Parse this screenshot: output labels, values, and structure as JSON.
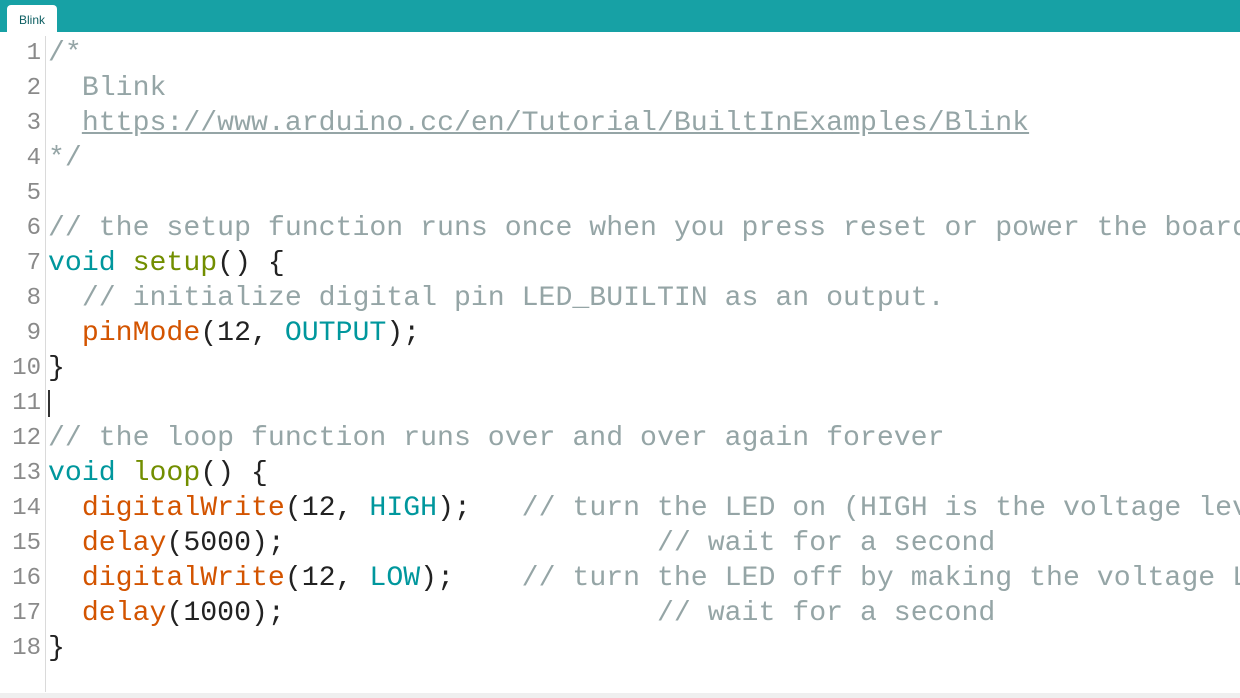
{
  "tabs": [
    {
      "label": "Blink",
      "active": true
    }
  ],
  "colors": {
    "header": "#17a1a5",
    "comment": "#95a5a6",
    "keyword": "#00979d",
    "function": "#d35400",
    "name": "#728e00"
  },
  "editor": {
    "cursor_line": 11,
    "lines": [
      [
        [
          "comment",
          "/*"
        ]
      ],
      [
        [
          "comment",
          "  Blink"
        ]
      ],
      [
        [
          "comment",
          "  "
        ],
        [
          "link",
          "https://www.arduino.cc/en/Tutorial/BuiltInExamples/Blink"
        ]
      ],
      [
        [
          "comment",
          "*/"
        ]
      ],
      [],
      [
        [
          "comment",
          "// the setup function runs once when you press reset or power the board"
        ]
      ],
      [
        [
          "kw",
          "void"
        ],
        [
          "plain",
          " "
        ],
        [
          "name",
          "setup"
        ],
        [
          "plain",
          "() {"
        ]
      ],
      [
        [
          "comment",
          "  // initialize digital pin LED_BUILTIN as an output."
        ]
      ],
      [
        [
          "plain",
          "  "
        ],
        [
          "fn",
          "pinMode"
        ],
        [
          "plain",
          "(12, "
        ],
        [
          "kw",
          "OUTPUT"
        ],
        [
          "plain",
          ");"
        ]
      ],
      [
        [
          "plain",
          "}"
        ]
      ],
      [],
      [
        [
          "comment",
          "// the loop function runs over and over again forever"
        ]
      ],
      [
        [
          "kw",
          "void"
        ],
        [
          "plain",
          " "
        ],
        [
          "name",
          "loop"
        ],
        [
          "plain",
          "() {"
        ]
      ],
      [
        [
          "plain",
          "  "
        ],
        [
          "fn",
          "digitalWrite"
        ],
        [
          "plain",
          "(12, "
        ],
        [
          "kw",
          "HIGH"
        ],
        [
          "plain",
          ");   "
        ],
        [
          "comment",
          "// turn the LED on (HIGH is the voltage level)"
        ]
      ],
      [
        [
          "plain",
          "  "
        ],
        [
          "fn",
          "delay"
        ],
        [
          "plain",
          "(5000);                      "
        ],
        [
          "comment",
          "// wait for a second"
        ]
      ],
      [
        [
          "plain",
          "  "
        ],
        [
          "fn",
          "digitalWrite"
        ],
        [
          "plain",
          "(12, "
        ],
        [
          "kw",
          "LOW"
        ],
        [
          "plain",
          ");    "
        ],
        [
          "comment",
          "// turn the LED off by making the voltage LOW"
        ]
      ],
      [
        [
          "plain",
          "  "
        ],
        [
          "fn",
          "delay"
        ],
        [
          "plain",
          "(1000);                      "
        ],
        [
          "comment",
          "// wait for a second"
        ]
      ],
      [
        [
          "plain",
          "}"
        ]
      ]
    ]
  }
}
